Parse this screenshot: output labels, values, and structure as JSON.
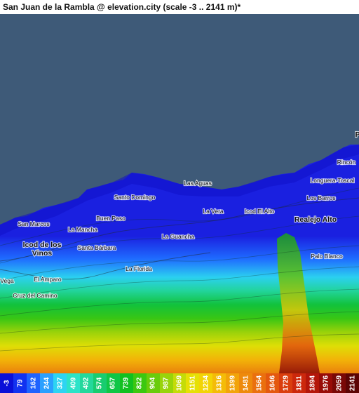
{
  "title": "San Juan de la Rambla @ elevation.city (scale -3 .. 2141 m)*",
  "places": [
    {
      "key": "santo-domingo",
      "label": "Santo Domingo",
      "major": false
    },
    {
      "key": "la-vera",
      "label": "La Vera",
      "major": false
    },
    {
      "key": "icod-el-alto",
      "label": "Icod El Alto",
      "major": false
    },
    {
      "key": "realejo-alto",
      "label": "Realejo Alto",
      "major": true
    },
    {
      "key": "los-barros",
      "label": "Los Barros",
      "major": false
    },
    {
      "key": "longuera-toscal",
      "label": "Longuera-Toscal",
      "major": false
    },
    {
      "key": "buen-paso",
      "label": "Buen Paso",
      "major": false
    },
    {
      "key": "san-marcos",
      "label": "San Marcos",
      "major": false
    },
    {
      "key": "la-mancha",
      "label": "La Mancha",
      "major": false
    },
    {
      "key": "icod-de-los-vinos",
      "label": "Icod de los\nVinos",
      "major": true
    },
    {
      "key": "santa-barbara",
      "label": "Santa Bárbara",
      "major": false
    },
    {
      "key": "la-guancha",
      "label": "La Guancha",
      "major": false
    },
    {
      "key": "la-florida",
      "label": "La Florida",
      "major": false
    },
    {
      "key": "palo-blanco",
      "label": "Palo Blanco",
      "major": false
    },
    {
      "key": "el-amparo",
      "label": "El Amparo",
      "major": false
    },
    {
      "key": "vega",
      "label": "Vega",
      "major": false
    },
    {
      "key": "cruz-del-camino",
      "label": "Cruz del Camino",
      "major": false
    },
    {
      "key": "las-aguas",
      "label": "Las Aguas",
      "major": false
    },
    {
      "key": "el-rincon",
      "label": "Rincón",
      "major": false
    },
    {
      "key": "p-edge",
      "label": "P",
      "major": true
    }
  ],
  "legend": [
    {
      "label": "-3",
      "color": "#0a10d8"
    },
    {
      "label": "79",
      "color": "#1232f0"
    },
    {
      "label": "162",
      "color": "#1f63ff"
    },
    {
      "label": "244",
      "color": "#2aa0ff"
    },
    {
      "label": "327",
      "color": "#2ed4f2"
    },
    {
      "label": "409",
      "color": "#2ce3c8"
    },
    {
      "label": "492",
      "color": "#24d89c"
    },
    {
      "label": "574",
      "color": "#18cc70"
    },
    {
      "label": "657",
      "color": "#10c646"
    },
    {
      "label": "739",
      "color": "#12c020"
    },
    {
      "label": "822",
      "color": "#3cc810"
    },
    {
      "label": "904",
      "color": "#6acc0c"
    },
    {
      "label": "987",
      "color": "#98d40a"
    },
    {
      "label": "1069",
      "color": "#c4dc08"
    },
    {
      "label": "1151",
      "color": "#e6e006"
    },
    {
      "label": "1234",
      "color": "#f2d406"
    },
    {
      "label": "1316",
      "color": "#f4bc08"
    },
    {
      "label": "1399",
      "color": "#f2a40a"
    },
    {
      "label": "1481",
      "color": "#ee8a0c"
    },
    {
      "label": "1564",
      "color": "#ea700e"
    },
    {
      "label": "1646",
      "color": "#e4580e"
    },
    {
      "label": "1729",
      "color": "#da3e0e"
    },
    {
      "label": "1811",
      "color": "#cc280c"
    },
    {
      "label": "1894",
      "color": "#b4160a"
    },
    {
      "label": "1976",
      "color": "#980c08"
    },
    {
      "label": "2059",
      "color": "#7a0806"
    },
    {
      "label": "2141",
      "color": "#5c0404"
    }
  ],
  "colors": {
    "sea": "#3e5a78"
  }
}
